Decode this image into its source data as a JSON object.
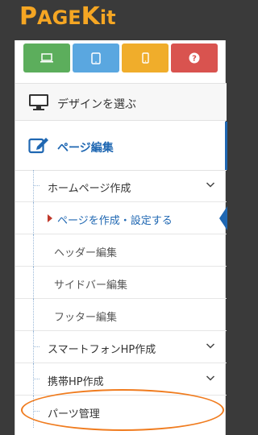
{
  "logo": {
    "text_big": "P",
    "text_mid": "AGE",
    "text_big2": "K",
    "text_end": "it"
  },
  "devices": [
    {
      "name": "laptop-icon",
      "color": "#5cae5c"
    },
    {
      "name": "tablet-icon",
      "color": "#5aa7e0"
    },
    {
      "name": "mobile-icon",
      "color": "#f0ad2b"
    },
    {
      "name": "help-icon",
      "color": "#d9534f"
    }
  ],
  "menu": {
    "design_label": "デザインを選ぶ",
    "edit_label": "ページ編集",
    "items": [
      {
        "label": "ホームページ作成",
        "expandable": true
      },
      {
        "label": "ページを作成・設定する",
        "active": true
      },
      {
        "label": "ヘッダー編集"
      },
      {
        "label": "サイドバー編集"
      },
      {
        "label": "フッター編集"
      },
      {
        "label": "スマートフォンHP作成",
        "expandable": true
      },
      {
        "label": "携帯HP作成",
        "expandable": true
      },
      {
        "label": "パーツ管理"
      }
    ]
  },
  "colors": {
    "accent": "#1f67b2",
    "highlight": "#f07c1f",
    "logo": "#f5a623"
  }
}
